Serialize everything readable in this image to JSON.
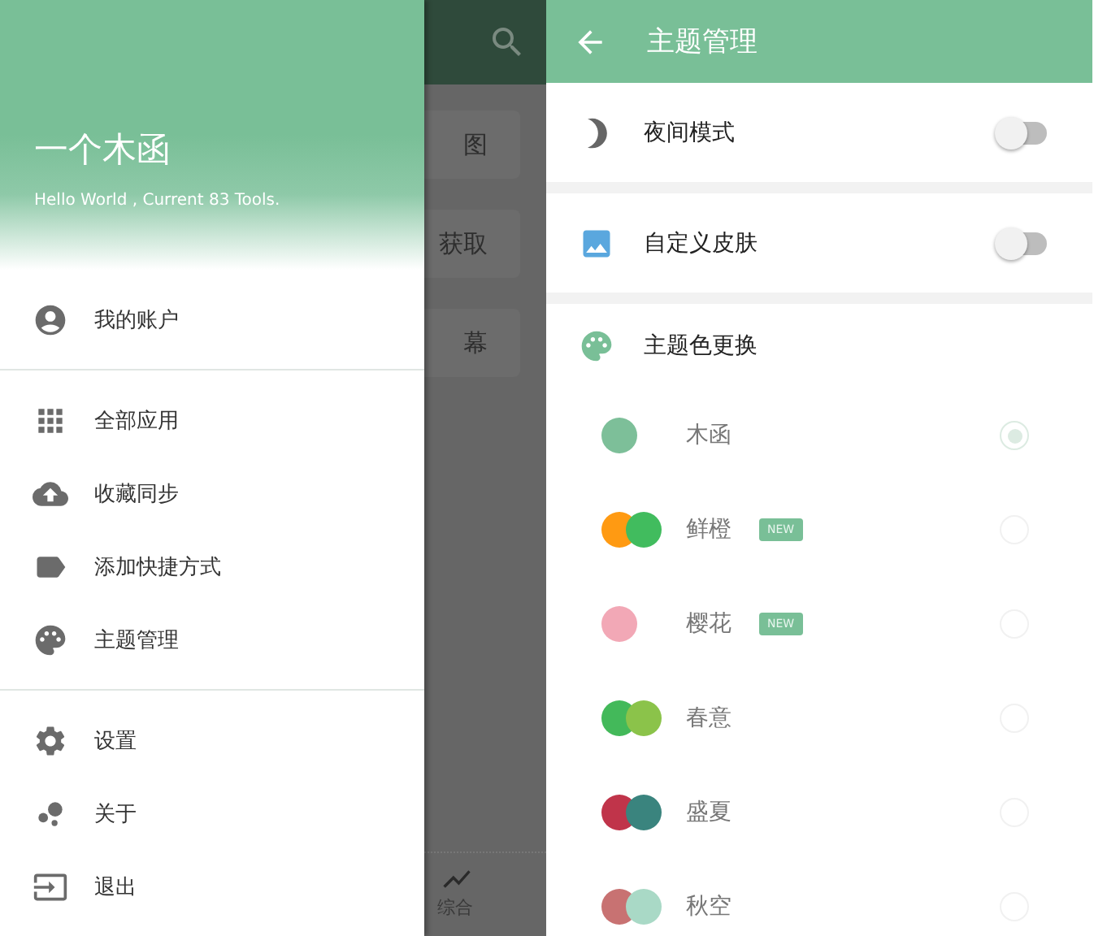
{
  "background_app": {
    "cards": [
      "图",
      "获取",
      "幕"
    ],
    "bottom_tab": "综合"
  },
  "drawer": {
    "title": "一个木函",
    "subtitle": "Hello World , Current 83 Tools.",
    "sections": [
      [
        {
          "label": "我的账户"
        }
      ],
      [
        {
          "label": "全部应用"
        },
        {
          "label": "收藏同步"
        },
        {
          "label": "添加快捷方式"
        },
        {
          "label": "主题管理"
        }
      ],
      [
        {
          "label": "设置"
        },
        {
          "label": "关于"
        },
        {
          "label": "退出"
        }
      ]
    ]
  },
  "theme_screen": {
    "title": "主题管理",
    "settings": [
      {
        "label": "夜间模式",
        "on": false
      },
      {
        "label": "自定义皮肤",
        "on": false
      }
    ],
    "color_section": {
      "title": "主题色更换",
      "themes": [
        {
          "name": "木函",
          "swatches": [
            {
              "color": "#7dbf99"
            }
          ],
          "selected": true,
          "new": false
        },
        {
          "name": "鲜橙",
          "swatches": [
            {
              "color": "#ff9a12"
            },
            {
              "color": "#41bc5e"
            }
          ],
          "selected": false,
          "new": true,
          "badge": "NEW"
        },
        {
          "name": "樱花",
          "swatches": [
            {
              "color": "#f2a8b6"
            }
          ],
          "selected": false,
          "new": true,
          "badge": "NEW"
        },
        {
          "name": "春意",
          "swatches": [
            {
              "color": "#43b95a"
            },
            {
              "color": "#8bc34a"
            }
          ],
          "selected": false,
          "new": false
        },
        {
          "name": "盛夏",
          "swatches": [
            {
              "color": "#c0344a"
            },
            {
              "color": "#3a847e"
            }
          ],
          "selected": false,
          "new": false
        },
        {
          "name": "秋空",
          "swatches": [
            {
              "color": "#c87272"
            },
            {
              "color": "#a9d9c6"
            }
          ],
          "selected": false,
          "new": false
        }
      ]
    }
  }
}
